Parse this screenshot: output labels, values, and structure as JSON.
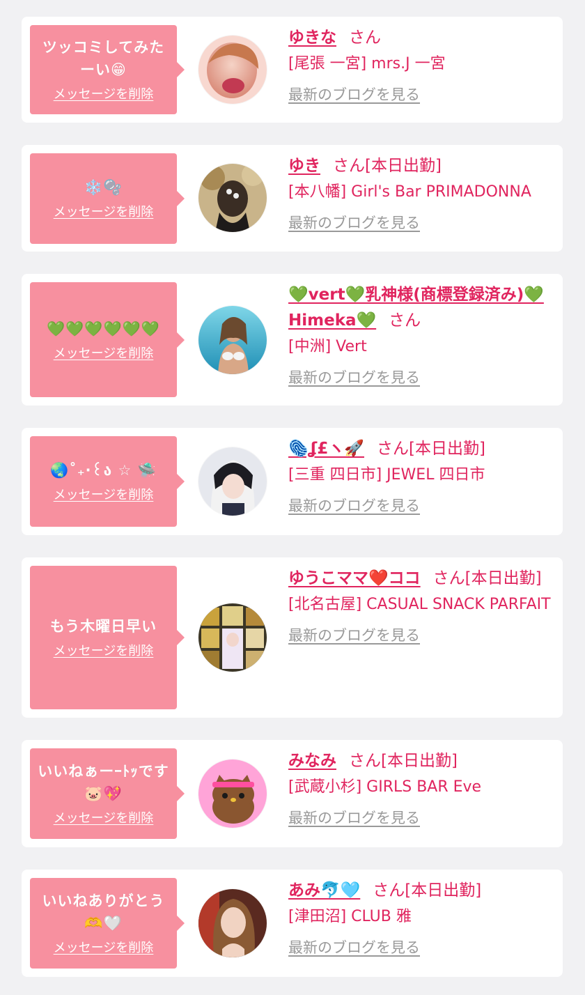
{
  "delete_label": "メッセージを削除",
  "blog_label": "最新のブログを見る",
  "colors": {
    "accent": "#e0245e",
    "bubble": "#f7909f",
    "background": "#f1f1f3",
    "card": "#ffffff"
  },
  "items": [
    {
      "message": "ツッコミしてみたーい😁",
      "name": "ゆきな",
      "suffix": "さん",
      "shop": "[尾張 一宮] mrs.J 一宮"
    },
    {
      "message": "❄️🫧",
      "name": "ゆき",
      "suffix": "さん[本日出勤]",
      "shop": "[本八幡] Girl's Bar PRIMADONNA"
    },
    {
      "message": "💚💚💚💚💚💚",
      "name": "💚vert💚乳神様(商標登録済み)💚Himeka💚",
      "suffix": "さん",
      "shop": "[中洲] Vert"
    },
    {
      "message": "🌏˚₊‧꒰ა ☆ 🛸",
      "name": "🫆ʆ£ヽ🚀",
      "suffix": "さん[本日出勤]",
      "shop": "[三重 四日市] JEWEL 四日市"
    },
    {
      "message": "もう木曜日早い",
      "name": "ゆうこママ❤️ココ",
      "suffix": "さん[本日出勤]",
      "shop": "[北名古屋] CASUAL SNACK PARFAIT"
    },
    {
      "message": "いいねぁーｰﾄｯです🐷💖",
      "name": "みなみ",
      "suffix": "さん[本日出勤]",
      "shop": "[武蔵小杉] GIRLS BAR Eve"
    },
    {
      "message": "いいねありがとう🫶🤍",
      "name": "あみ🐬🩵",
      "suffix": "さん[本日出勤]",
      "shop": "[津田沼] CLUB 雅"
    }
  ]
}
